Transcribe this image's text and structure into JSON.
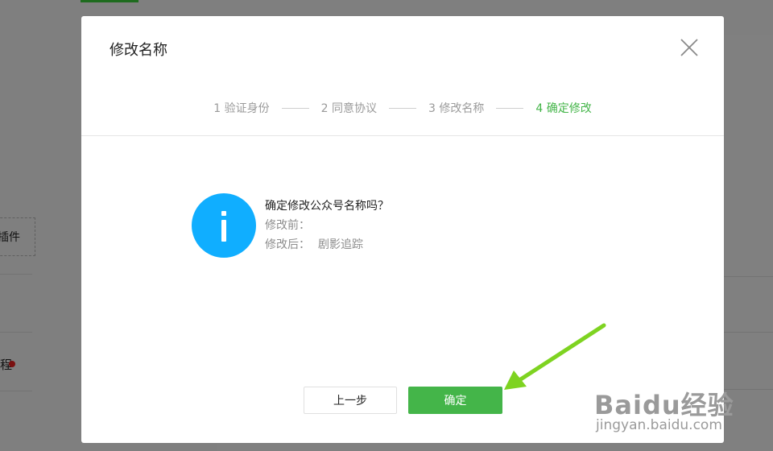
{
  "background": {
    "plugin_label": "插件",
    "side_text": "程"
  },
  "watermark": {
    "logo": "Baidu经验",
    "url": "jingyan.baidu.com"
  },
  "modal": {
    "title": "修改名称",
    "steps": [
      {
        "label": "1 验证身份",
        "active": false
      },
      {
        "label": "2 同意协议",
        "active": false
      },
      {
        "label": "3 修改名称",
        "active": false
      },
      {
        "label": "4 确定修改",
        "active": true
      }
    ],
    "confirm_text": "确定修改公众号名称吗？",
    "before_label": "修改前：",
    "before_value": "",
    "after_label": "修改后：",
    "after_value": "剧影追踪",
    "prev_button": "上一步",
    "ok_button": "确定",
    "icon": "info-icon",
    "colors": {
      "accent": "#44b549",
      "info": "#10aeff"
    }
  }
}
